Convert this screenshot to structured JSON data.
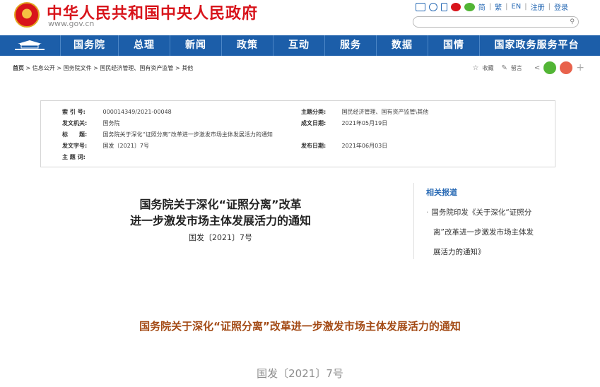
{
  "header": {
    "site_name": "中华人民共和国中央人民政府",
    "site_url": "www.gov.cn",
    "lang_links": [
      "简",
      "繁",
      "EN",
      "注册",
      "登录"
    ]
  },
  "nav": {
    "items": [
      "国务院",
      "总理",
      "新闻",
      "政策",
      "互动",
      "服务",
      "数据",
      "国情",
      "国家政务服务平台"
    ]
  },
  "breadcrumb": {
    "home": "首页",
    "items": [
      "信息公开",
      "国务院文件",
      "国民经济管理、国有资产监管",
      "其他"
    ]
  },
  "share": {
    "collect_label": "收藏",
    "comment_label": "留言"
  },
  "meta": {
    "index_label": "索 引 号:",
    "index_value": "000014349/2021-00048",
    "issuer_label": "发文机关:",
    "issuer_value": "国务院",
    "title_label": "标　　题:",
    "title_value": "国务院关于深化“证照分离”改革进一步激发市场主体发展活力的通知",
    "docnum_label": "发文字号:",
    "docnum_value": "国发〔2021〕7号",
    "keywords_label": "主 题 词:",
    "keywords_value": "",
    "category_label": "主题分类:",
    "category_value": "国民经济管理、国有资产监管\\其他",
    "created_label": "成文日期:",
    "created_value": "2021年05月19日",
    "published_label": "发布日期:",
    "published_value": "2021年06月03日"
  },
  "document": {
    "title_line1": "国务院关于深化“证照分离”改革",
    "title_line2": "进一步激发市场主体发展活力的通知",
    "number": "国发〔2021〕7号"
  },
  "related": {
    "heading": "相关报道",
    "item_lines": [
      "国务院印发《关于深化“证照分",
      "离”改革进一步激发市场主体发",
      "展活力的通知》"
    ]
  },
  "article": {
    "title": "国务院关于深化“证照分离”改革进一步激发市场主体发展活力的通知",
    "number": "国发〔2021〕7号"
  },
  "colors": {
    "nav_bg": "#1c5ea9",
    "brand_red": "#d8141b",
    "link_blue": "#2a6bb5",
    "article_title": "#a34a15"
  }
}
